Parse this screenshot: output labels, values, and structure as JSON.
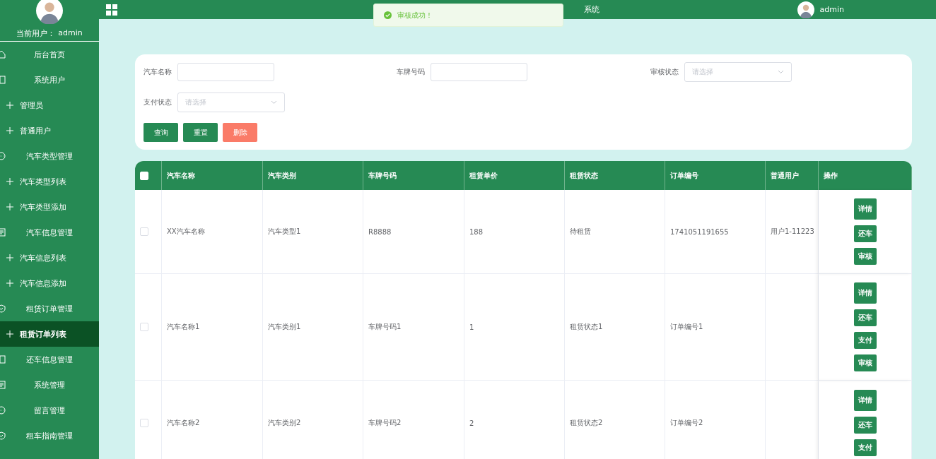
{
  "sidebar": {
    "current_user_label": "当前用户：",
    "current_user": "admin",
    "items": [
      {
        "label": "后台首页",
        "kind": "home",
        "selected": false
      },
      {
        "label": "系统用户",
        "kind": "panel",
        "selected": false
      },
      {
        "label": "管理员",
        "kind": "plus",
        "selected": false
      },
      {
        "label": "普通用户",
        "kind": "plus",
        "selected": false
      },
      {
        "label": "汽车类型管理",
        "kind": "chat",
        "selected": false
      },
      {
        "label": "汽车类型列表",
        "kind": "plus",
        "selected": false
      },
      {
        "label": "汽车类型添加",
        "kind": "plus",
        "selected": false
      },
      {
        "label": "汽车信息管理",
        "kind": "doc",
        "selected": false
      },
      {
        "label": "汽车信息列表",
        "kind": "plus",
        "selected": false
      },
      {
        "label": "汽车信息添加",
        "kind": "plus",
        "selected": false
      },
      {
        "label": "租赁订单管理",
        "kind": "shield",
        "selected": false
      },
      {
        "label": "租赁订单列表",
        "kind": "plus",
        "selected": true
      },
      {
        "label": "还车信息管理",
        "kind": "panel",
        "selected": false
      },
      {
        "label": "系统管理",
        "kind": "doc",
        "selected": false
      },
      {
        "label": "留言管理",
        "kind": "chat",
        "selected": false
      },
      {
        "label": "租车指南管理",
        "kind": "shield",
        "selected": false
      }
    ]
  },
  "header": {
    "title": "系统",
    "user": "admin"
  },
  "toast": {
    "message": "审核成功！"
  },
  "filters": [
    {
      "label": "汽车名称",
      "kind": "input"
    },
    {
      "label": "车牌号码",
      "kind": "input"
    },
    {
      "label": "审核状态",
      "kind": "select",
      "placeholder": "请选择"
    },
    {
      "label": "支付状态",
      "kind": "select",
      "placeholder": "请选择"
    }
  ],
  "filter_buttons": [
    {
      "label": "查询",
      "kind": "primary"
    },
    {
      "label": "重置",
      "kind": "primary"
    },
    {
      "label": "删除",
      "kind": "danger"
    }
  ],
  "table": {
    "all_checked": false,
    "columns": [
      "汽车名称",
      "汽车类别",
      "车牌号码",
      "租赁单价",
      "租赁状态",
      "订单编号",
      "普通用户",
      "操作"
    ],
    "rows": [
      {
        "selected": false,
        "cells": [
          "XX汽车名称",
          "汽车类型1",
          "R8888",
          "188",
          "待租赁",
          "1741051191655",
          "用户1-11223"
        ],
        "actions": [
          "详情",
          "还车",
          "审核"
        ]
      },
      {
        "selected": false,
        "cells": [
          "汽车名称1",
          "汽车类别1",
          "车牌号码1",
          "1",
          "租赁状态1",
          "订单编号1",
          ""
        ],
        "actions": [
          "详情",
          "还车",
          "支付",
          "审核"
        ]
      },
      {
        "selected": false,
        "cells": [
          "汽车名称2",
          "汽车类别2",
          "车牌号码2",
          "2",
          "租赁状态2",
          "订单编号2",
          ""
        ],
        "actions": [
          "详情",
          "还车",
          "支付"
        ]
      }
    ]
  }
}
